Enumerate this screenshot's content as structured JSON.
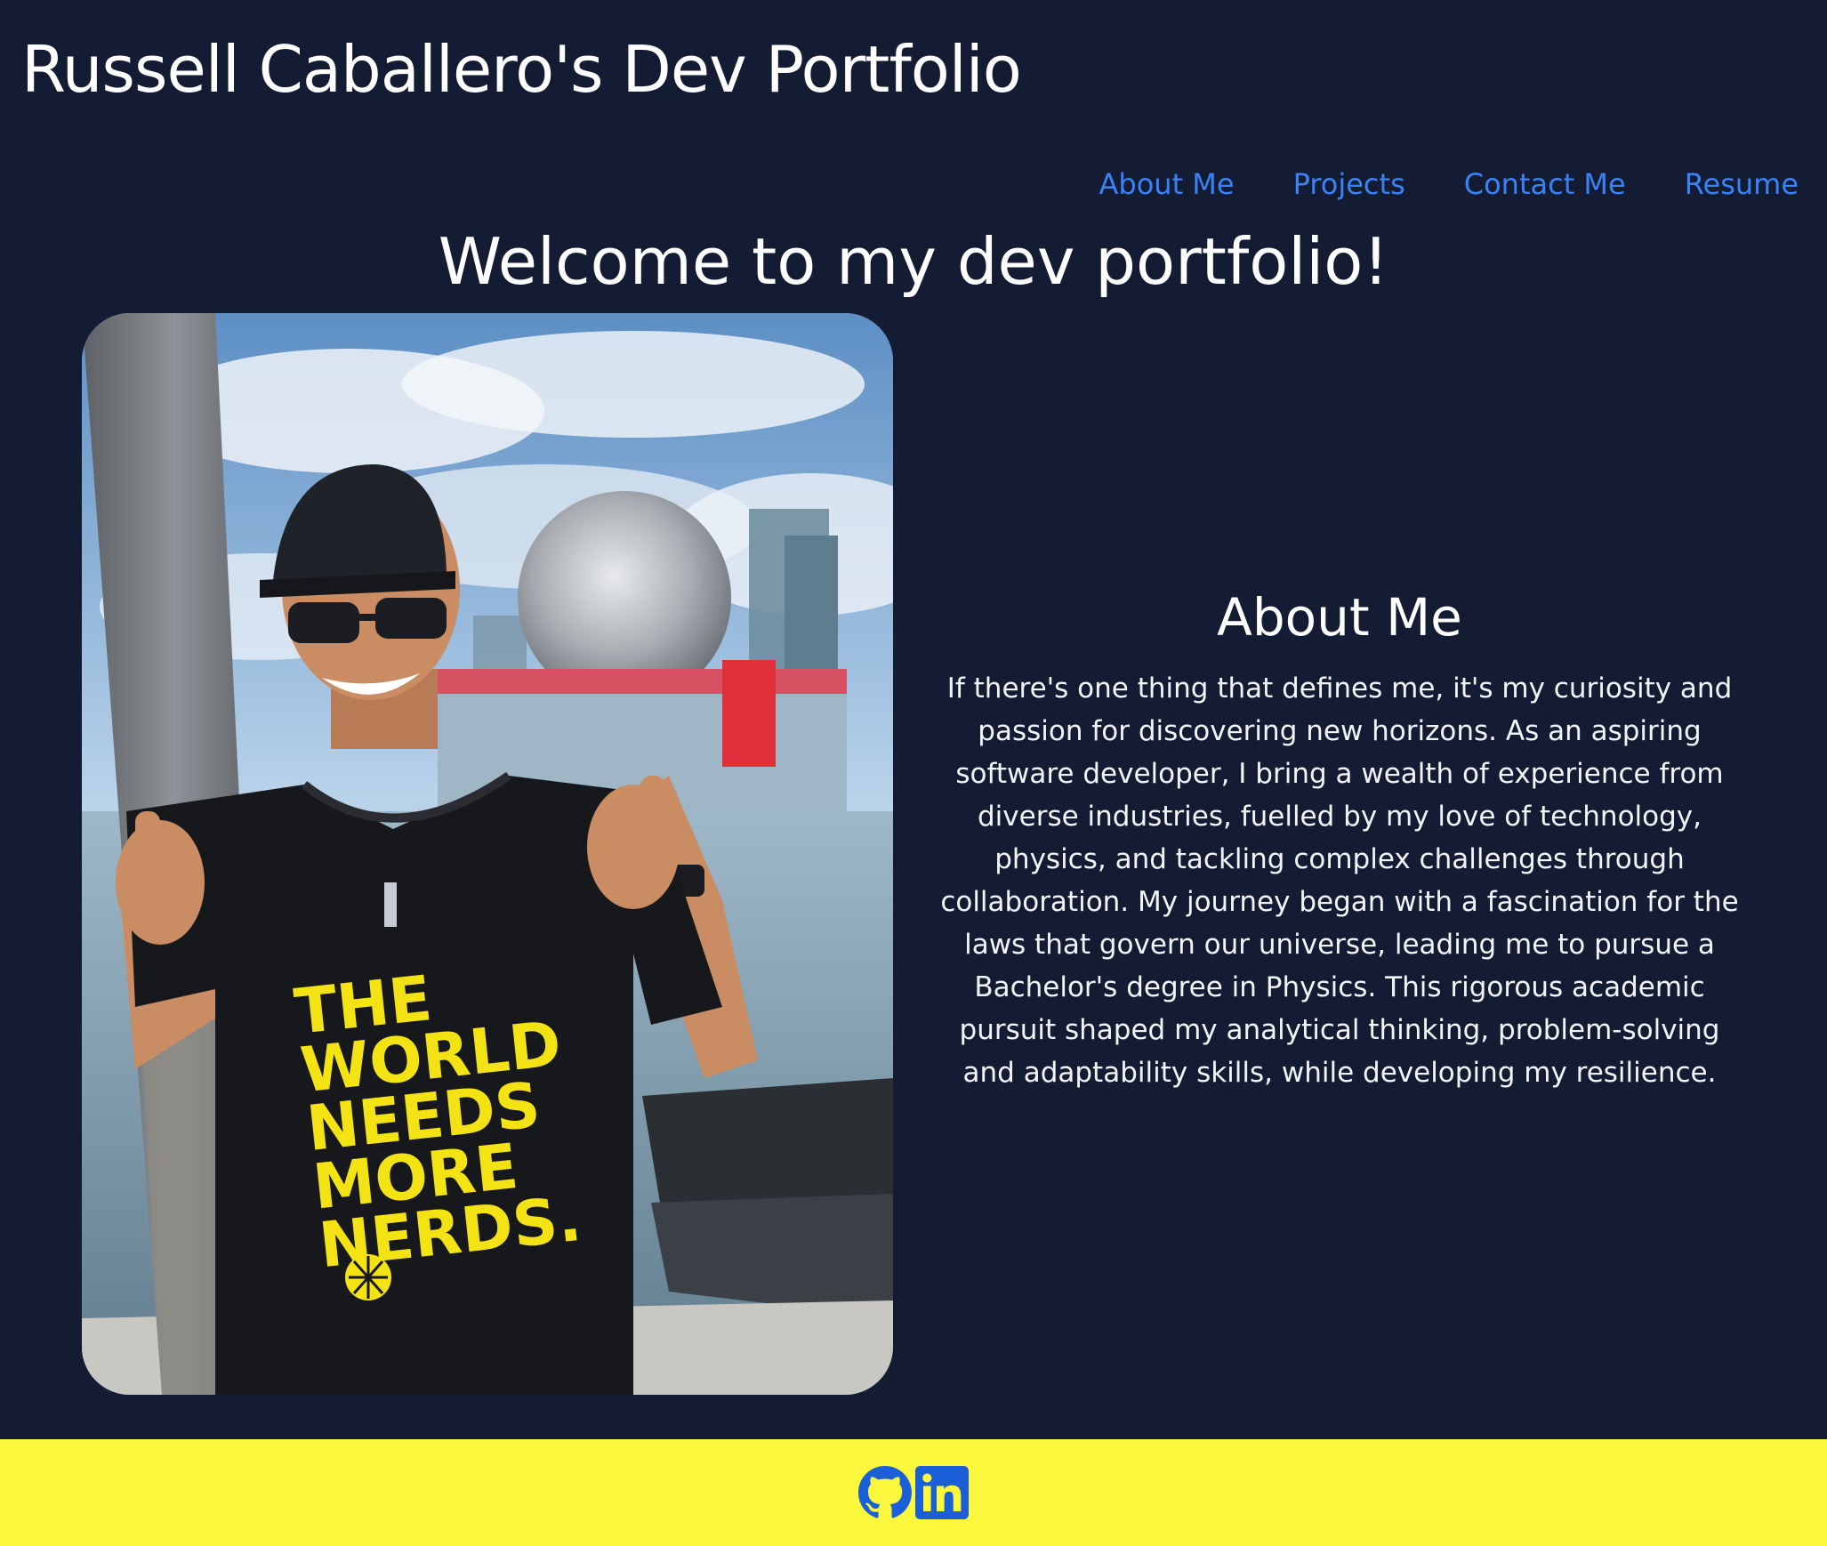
{
  "header": {
    "title": "Russell Caballero's Dev Portfolio"
  },
  "nav": {
    "items": [
      {
        "label": "About Me"
      },
      {
        "label": "Projects"
      },
      {
        "label": "Contact Me"
      },
      {
        "label": "Resume"
      }
    ]
  },
  "welcome": {
    "heading": "Welcome to my dev portfolio!"
  },
  "photo": {
    "shirt_text": [
      "THE",
      "WORLD",
      "NEEDS",
      "MORE",
      "NERDS."
    ]
  },
  "about": {
    "heading": "About Me",
    "text": "If there's one thing that defines me, it's my curiosity and passion for discovering new horizons. As an aspiring software developer, I bring a wealth of experience from diverse industries, fuelled by my love of technology, physics, and tackling complex challenges through collaboration. My journey began with a fascination for the laws that govern our universe, leading me to pursue a Bachelor's degree in Physics. This rigorous academic pursuit shaped my analytical thinking, problem-solving and adaptability skills, while developing my resilience."
  },
  "footer": {
    "icons": [
      "github-icon",
      "linkedin-icon"
    ]
  },
  "colors": {
    "background": "#131c33",
    "link": "#3b82f6",
    "footer": "#faf73c",
    "text": "#ffffff"
  }
}
